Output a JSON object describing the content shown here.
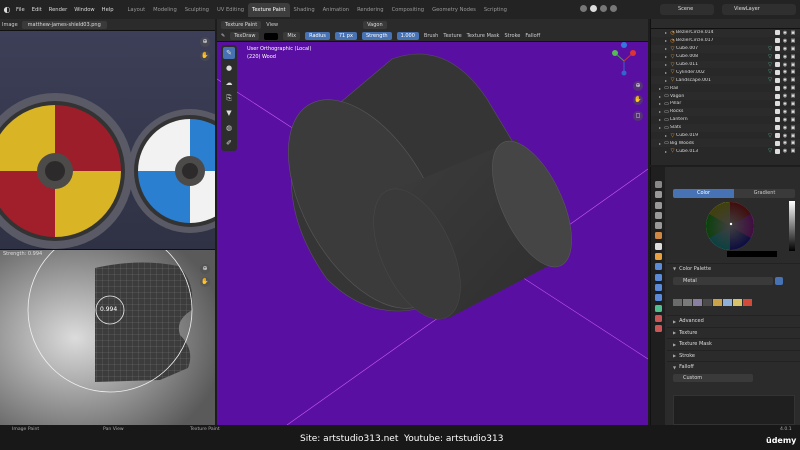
{
  "menu": [
    "File",
    "Edit",
    "Render",
    "Window",
    "Help"
  ],
  "workspaces": [
    "Layout",
    "Modeling",
    "Sculpting",
    "UV Editing",
    "Texture Paint",
    "Shading",
    "Animation",
    "Rendering",
    "Compositing",
    "Geometry Nodes",
    "Scripting"
  ],
  "scene": "Scene",
  "view_layer": "ViewLayer",
  "image_editor": {
    "mode_label": "Image",
    "filename": "matthew-james-shield03.png"
  },
  "uv_editor": {
    "strength_label": "Strength: 0.994",
    "value": "0.994"
  },
  "viewport": {
    "mode": "Texture Paint",
    "view_menu": "View",
    "brush_name": "TexDraw",
    "blend": "Mix",
    "radius_label": "Radius",
    "radius_value": "71 px",
    "strength_label": "Strength",
    "strength_value": "1.000",
    "brush_menu": "Brush",
    "texture_menu": "Texture",
    "texture_mask_menu": "Texture Mask",
    "stroke_menu": "Stroke",
    "falloff_menu": "Falloff",
    "object_slot": "Vagon",
    "view_name": "User Orthographic (Local)",
    "object_info": "(220) Wood"
  },
  "outliner": [
    {
      "name": "BezierCircle.014",
      "type": "curve",
      "indent": 2
    },
    {
      "name": "BezierCircle.017",
      "type": "curve",
      "indent": 2
    },
    {
      "name": "Cube.007",
      "type": "mesh",
      "indent": 2
    },
    {
      "name": "Cube.008",
      "type": "mesh",
      "indent": 2
    },
    {
      "name": "Cube.011",
      "type": "mesh",
      "indent": 2
    },
    {
      "name": "Cylinder.002",
      "type": "mesh",
      "indent": 2
    },
    {
      "name": "Landscape.001",
      "type": "mesh",
      "indent": 2
    },
    {
      "name": "Rail",
      "type": "collection",
      "indent": 1
    },
    {
      "name": "Vagon",
      "type": "collection",
      "indent": 1
    },
    {
      "name": "Pillar",
      "type": "collection",
      "indent": 1
    },
    {
      "name": "Rocks",
      "type": "collection",
      "indent": 1
    },
    {
      "name": "Lantern",
      "type": "collection",
      "indent": 1
    },
    {
      "name": "Slats",
      "type": "collection",
      "indent": 1
    },
    {
      "name": "Cube.019",
      "type": "mesh",
      "indent": 2
    },
    {
      "name": "Big Woods",
      "type": "collection",
      "indent": 1
    },
    {
      "name": "Cube.013",
      "type": "mesh",
      "indent": 2
    }
  ],
  "properties": {
    "color_tab": "Color",
    "gradient_tab": "Gradient",
    "color_palette_label": "Color Palette",
    "palette_name": "Metal",
    "sections": [
      "Advanced",
      "Texture",
      "Texture Mask",
      "Stroke",
      "Falloff"
    ],
    "falloff_preset": "Custom",
    "palette_swatches": [
      "#6b6b6b",
      "#7a7a7a",
      "#8a7fa0",
      "#4a4a4a",
      "#c9a24a",
      "#8fb0d8",
      "#d8c36a",
      "#d44a3a"
    ],
    "brush_color": "#000000"
  },
  "status_bar": {
    "left": [
      "Image Paint",
      "Pan View",
      "Texture Paint"
    ],
    "version": "4.0.1"
  },
  "watermark": {
    "site": "Site: artstudio313.net",
    "youtube": "Youtube: artstudio313",
    "brand": "ūdemy"
  },
  "colors": {
    "viewport_bg": "#5a0fa3",
    "accent": "#4772b3"
  }
}
